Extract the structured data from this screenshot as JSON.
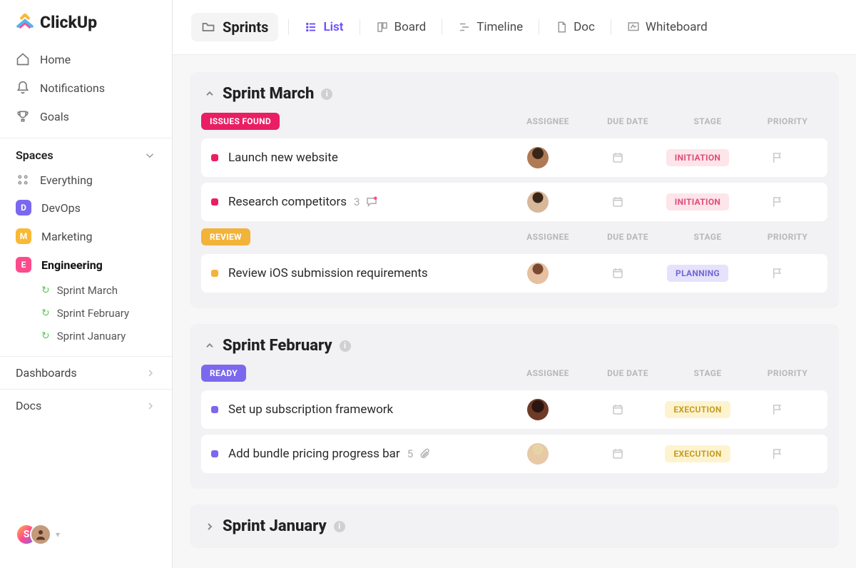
{
  "brand": "ClickUp",
  "sidebar": {
    "nav": [
      {
        "label": "Home"
      },
      {
        "label": "Notifications"
      },
      {
        "label": "Goals"
      }
    ],
    "spaces_header": "Spaces",
    "everything": "Everything",
    "spaces": [
      {
        "initial": "D",
        "label": "DevOps",
        "color": "purple"
      },
      {
        "initial": "M",
        "label": "Marketing",
        "color": "yellow"
      },
      {
        "initial": "E",
        "label": "Engineering",
        "color": "pink",
        "active": true
      }
    ],
    "sublists": [
      {
        "label": "Sprint  March"
      },
      {
        "label": "Sprint  February"
      },
      {
        "label": "Sprint January"
      }
    ],
    "dashboards": "Dashboards",
    "docs": "Docs",
    "user_initial": "S"
  },
  "topbar": {
    "folder": "Sprints",
    "views": [
      {
        "label": "List",
        "active": true
      },
      {
        "label": "Board",
        "active": false
      },
      {
        "label": "Timeline",
        "active": false
      },
      {
        "label": "Doc",
        "active": false
      },
      {
        "label": "Whiteboard",
        "active": false
      }
    ]
  },
  "columns": {
    "assignee": "ASSIGNEE",
    "duedate": "DUE DATE",
    "stage": "STAGE",
    "priority": "PRIORITY"
  },
  "sprints": [
    {
      "title": "Sprint March",
      "collapsed": false,
      "groups": [
        {
          "status": "ISSUES FOUND",
          "status_color": "pink",
          "tasks": [
            {
              "title": "Launch new website",
              "stage": "INITIATION",
              "stage_style": "init",
              "avatar": "#b07a55"
            },
            {
              "title": "Research competitors",
              "stage": "INITIATION",
              "stage_style": "init",
              "avatar": "#d8b89a",
              "comments": "3"
            }
          ]
        },
        {
          "status": "REVIEW",
          "status_color": "gold",
          "tasks": [
            {
              "title": "Review iOS submission requirements",
              "stage": "PLANNING",
              "stage_style": "plan",
              "avatar": "#d19a78"
            }
          ]
        }
      ]
    },
    {
      "title": "Sprint February",
      "collapsed": false,
      "groups": [
        {
          "status": "READY",
          "status_color": "violet",
          "tasks": [
            {
              "title": "Set up subscription framework",
              "stage": "EXECUTION",
              "stage_style": "exec",
              "avatar": "#6e3b28"
            },
            {
              "title": "Add bundle pricing progress bar",
              "stage": "EXECUTION",
              "stage_style": "exec",
              "avatar": "#e7c9a6",
              "attachments": "5"
            }
          ]
        }
      ]
    },
    {
      "title": "Sprint January",
      "collapsed": true,
      "groups": []
    }
  ]
}
